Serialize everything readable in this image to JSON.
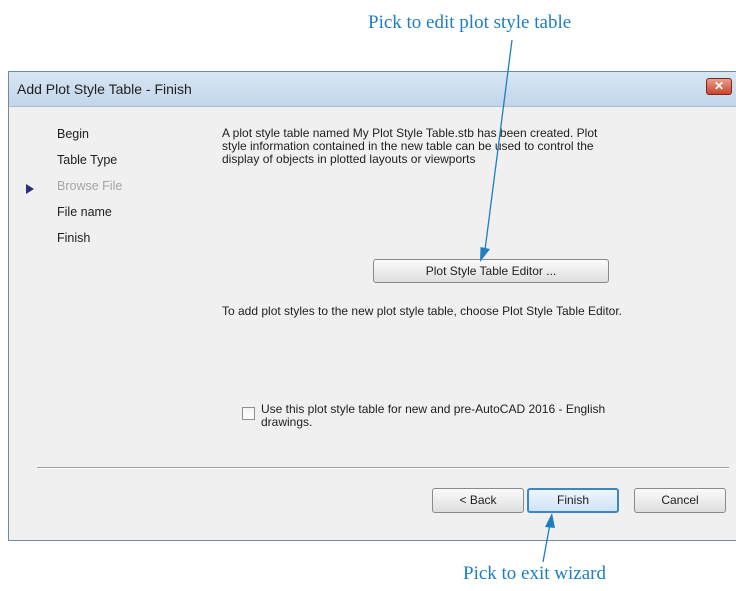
{
  "callouts": {
    "top": "Pick to edit plot style table",
    "bottom": "Pick to exit wizard"
  },
  "dialog": {
    "title": "Add Plot Style Table - Finish",
    "close_glyph": "✕",
    "steps": [
      {
        "label": "Begin",
        "enabled": true,
        "current": false
      },
      {
        "label": "Table Type",
        "enabled": true,
        "current": false
      },
      {
        "label": "Browse File",
        "enabled": false,
        "current": false
      },
      {
        "label": "File name",
        "enabled": true,
        "current": false
      },
      {
        "label": "Finish",
        "enabled": true,
        "current": true
      }
    ],
    "description": "A plot style table named My Plot Style Table.stb has been created. Plot style information contained in the new table can be used to control the display of objects in plotted layouts or viewports",
    "editor_button": "Plot Style Table Editor ...",
    "hint": "To add plot styles to the new plot style table, choose Plot Style Table Editor.",
    "checkbox": {
      "label": "Use this plot style table for new and pre-AutoCAD 2016 - English drawings.",
      "checked": false
    },
    "buttons": {
      "back": "< Back",
      "finish": "Finish",
      "cancel": "Cancel"
    }
  },
  "colors": {
    "callout": "#1d7fc1",
    "step_arrow": "#2b2e7a",
    "disabled_step": "#a4a4a4"
  },
  "icons": {
    "close": "close-icon",
    "current_step": "current-step-arrow-icon",
    "checkbox": "checkbox-icon"
  }
}
